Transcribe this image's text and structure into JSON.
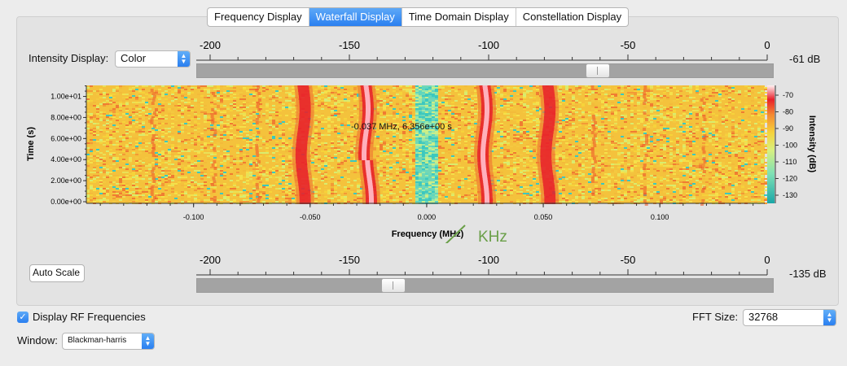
{
  "tabs": [
    {
      "label": "Frequency Display",
      "active": false
    },
    {
      "label": "Waterfall Display",
      "active": true
    },
    {
      "label": "Time Domain Display",
      "active": false
    },
    {
      "label": "Constellation Display",
      "active": false
    }
  ],
  "intensity_display": {
    "label": "Intensity Display:",
    "value": "Color"
  },
  "top_scale": {
    "ticks": [
      "-200",
      "-150",
      "-100",
      "-50",
      "0"
    ],
    "readout": "-61 dB",
    "slider_value_db": -61
  },
  "bottom_scale": {
    "ticks": [
      "-200",
      "-150",
      "-100",
      "-50",
      "0"
    ],
    "readout": "-135 dB",
    "slider_value_db": -135
  },
  "auto_scale_label": "Auto Scale",
  "waterfall": {
    "y_axis_label": "Time (s)",
    "y_ticks": [
      "0.00e+00",
      "2.00e+00",
      "4.00e+00",
      "6.00e+00",
      "8.00e+00",
      "1.00e+01"
    ],
    "x_axis_label": "Frequency (MHz)",
    "x_ticks": [
      "-0.100",
      "-0.050",
      "0.000",
      "0.050",
      "0.100"
    ],
    "colorbar_label": "Intensity (dB)",
    "colorbar_ticks": [
      "-70",
      "-80",
      "-90",
      "-100",
      "-110",
      "-120",
      "-130"
    ],
    "cursor_readout": "-0.037 MHz, 6.356e+00 s",
    "annotation": "KHz",
    "signal_lines_mhz": [
      -0.053,
      -0.026,
      0.025,
      0.052
    ],
    "bright_lines_mhz": [
      -0.026,
      0.025
    ],
    "center_band_mhz": 0.0
  },
  "display_rf": {
    "label": "Display RF Frequencies",
    "checked": true
  },
  "fft_size": {
    "label": "FFT Size:",
    "value": "32768"
  },
  "window": {
    "label": "Window:",
    "value": "Blackman-harris"
  },
  "colors": {
    "accent": "#2a7ff0",
    "annotation": "#6a9f48"
  }
}
